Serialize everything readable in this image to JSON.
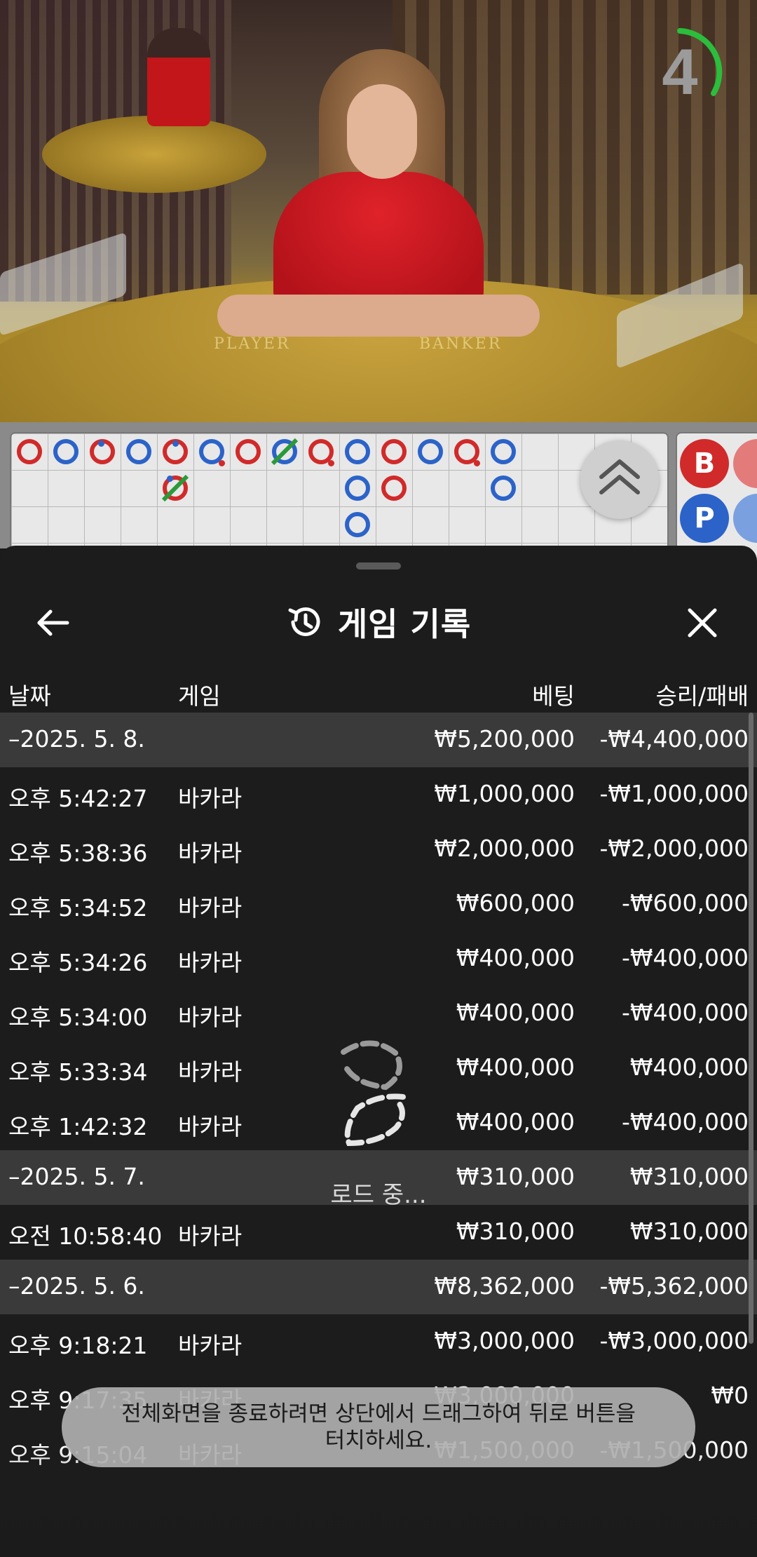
{
  "video": {
    "countdown": "4",
    "table_labels": [
      "PLAYER",
      "BANKER"
    ]
  },
  "roadmap": {
    "side_badges": [
      "B",
      "P"
    ]
  },
  "history": {
    "title": "게임 기록",
    "columns": {
      "date": "날짜",
      "game": "게임",
      "bet": "베팅",
      "result": "승리/패배"
    },
    "rows": [
      {
        "type": "date",
        "date": "–2025. 5. 8.",
        "bet": "₩5,200,000",
        "result": "-₩4,400,000"
      },
      {
        "type": "game",
        "date": "오후 5:42:27",
        "game": "바카라",
        "bet": "₩1,000,000",
        "result": "-₩1,000,000"
      },
      {
        "type": "game",
        "date": "오후 5:38:36",
        "game": "바카라",
        "bet": "₩2,000,000",
        "result": "-₩2,000,000"
      },
      {
        "type": "game",
        "date": "오후 5:34:52",
        "game": "바카라",
        "bet": "₩600,000",
        "result": "-₩600,000"
      },
      {
        "type": "game",
        "date": "오후 5:34:26",
        "game": "바카라",
        "bet": "₩400,000",
        "result": "-₩400,000"
      },
      {
        "type": "game",
        "date": "오후 5:34:00",
        "game": "바카라",
        "bet": "₩400,000",
        "result": "-₩400,000"
      },
      {
        "type": "game",
        "date": "오후 5:33:34",
        "game": "바카라",
        "bet": "₩400,000",
        "result": "₩400,000"
      },
      {
        "type": "game",
        "date": "오후 1:42:32",
        "game": "바카라",
        "bet": "₩400,000",
        "result": "-₩400,000"
      },
      {
        "type": "date",
        "date": "–2025. 5. 7.",
        "bet": "₩310,000",
        "result": "₩310,000"
      },
      {
        "type": "game",
        "date": "오전 10:58:40",
        "game": "바카라",
        "bet": "₩310,000",
        "result": "₩310,000"
      },
      {
        "type": "date",
        "date": "–2025. 5. 6.",
        "bet": "₩8,362,000",
        "result": "-₩5,362,000"
      },
      {
        "type": "game",
        "date": "오후 9:18:21",
        "game": "바카라",
        "bet": "₩3,000,000",
        "result": "-₩3,000,000"
      },
      {
        "type": "game",
        "date": "오후 9:17:35",
        "game": "바카라",
        "bet": "₩3,000,000",
        "result": "₩0"
      },
      {
        "type": "game",
        "date": "오후 9:15:04",
        "game": "바카라",
        "bet": "₩1,500,000",
        "result": "-₩1,500,000"
      }
    ],
    "loading_text": "로드 중..."
  },
  "toast": {
    "line1": "전체화면을 종료하려면 상단에서 드래그하여 뒤로 버튼을",
    "line2": "터치하세요."
  },
  "colors": {
    "banker": "#d12a2a",
    "player": "#2b63c9",
    "tie": "#2a9a3a",
    "timer": "#2bbd3c"
  }
}
